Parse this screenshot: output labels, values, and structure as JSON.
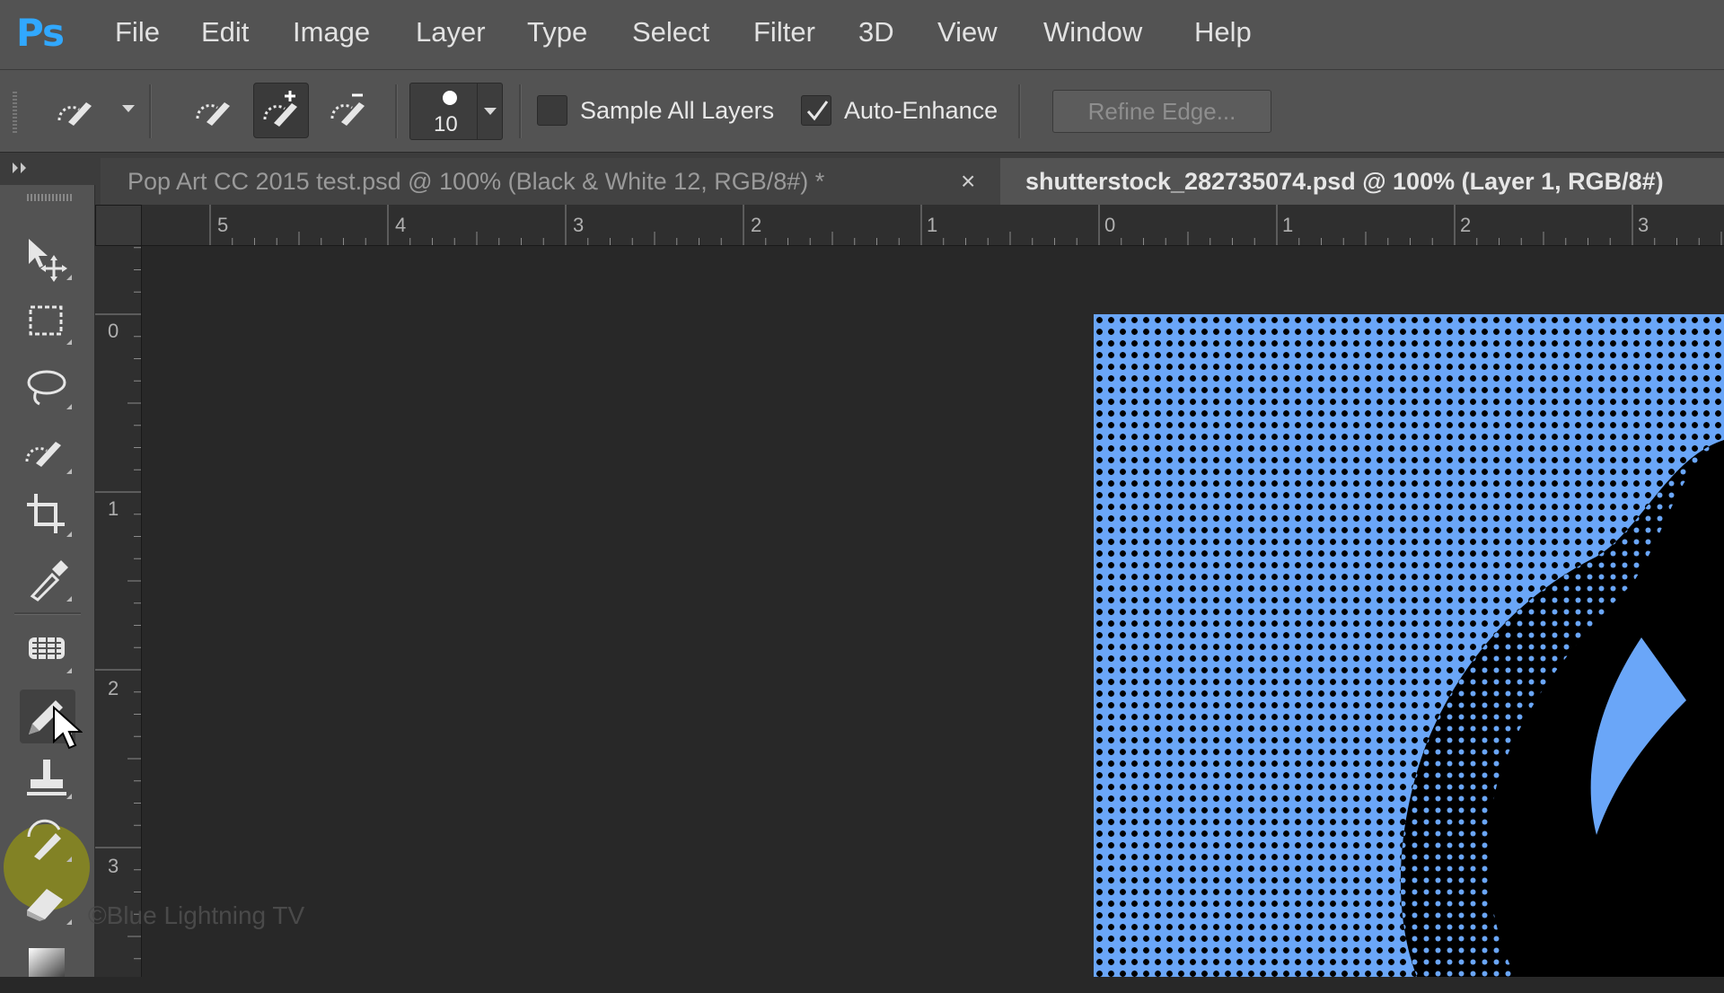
{
  "app": {
    "logo": "Ps"
  },
  "menu": [
    "File",
    "Edit",
    "Image",
    "Layer",
    "Type",
    "Select",
    "Filter",
    "3D",
    "View",
    "Window",
    "Help"
  ],
  "options": {
    "brush_size": "10",
    "sample_all_layers": {
      "label": "Sample All Layers",
      "checked": false
    },
    "auto_enhance": {
      "label": "Auto-Enhance",
      "checked": true
    },
    "refine_edge_label": "Refine Edge..."
  },
  "tabs": [
    {
      "title": "Pop Art CC 2015 test.psd @ 100% (Black & White 12, RGB/8#) *",
      "close": "×",
      "active": false
    },
    {
      "title": "shutterstock_282735074.psd @ 100% (Layer 1, RGB/8#)",
      "active": true
    }
  ],
  "ruler": {
    "horizontal": [
      "5",
      "4",
      "3",
      "2",
      "1",
      "0",
      "1",
      "2",
      "3"
    ],
    "vertical": [
      "0",
      "1",
      "2",
      "3"
    ]
  },
  "toolbox": {
    "tools": [
      "move-icon",
      "rectangular-marquee-icon",
      "lasso-icon",
      "quick-selection-icon",
      "crop-icon",
      "eyedropper-icon",
      "healing-brush-icon",
      "pencil-icon",
      "clone-stamp-icon",
      "history-brush-icon",
      "eraser-icon",
      "gradient-icon"
    ],
    "selected": "pencil-icon"
  },
  "watermark": "©Blue Lightning TV",
  "colors": {
    "accent": "#31a8ff",
    "image_blue": "#6aa6f8",
    "highlight": "#aaaa00"
  }
}
